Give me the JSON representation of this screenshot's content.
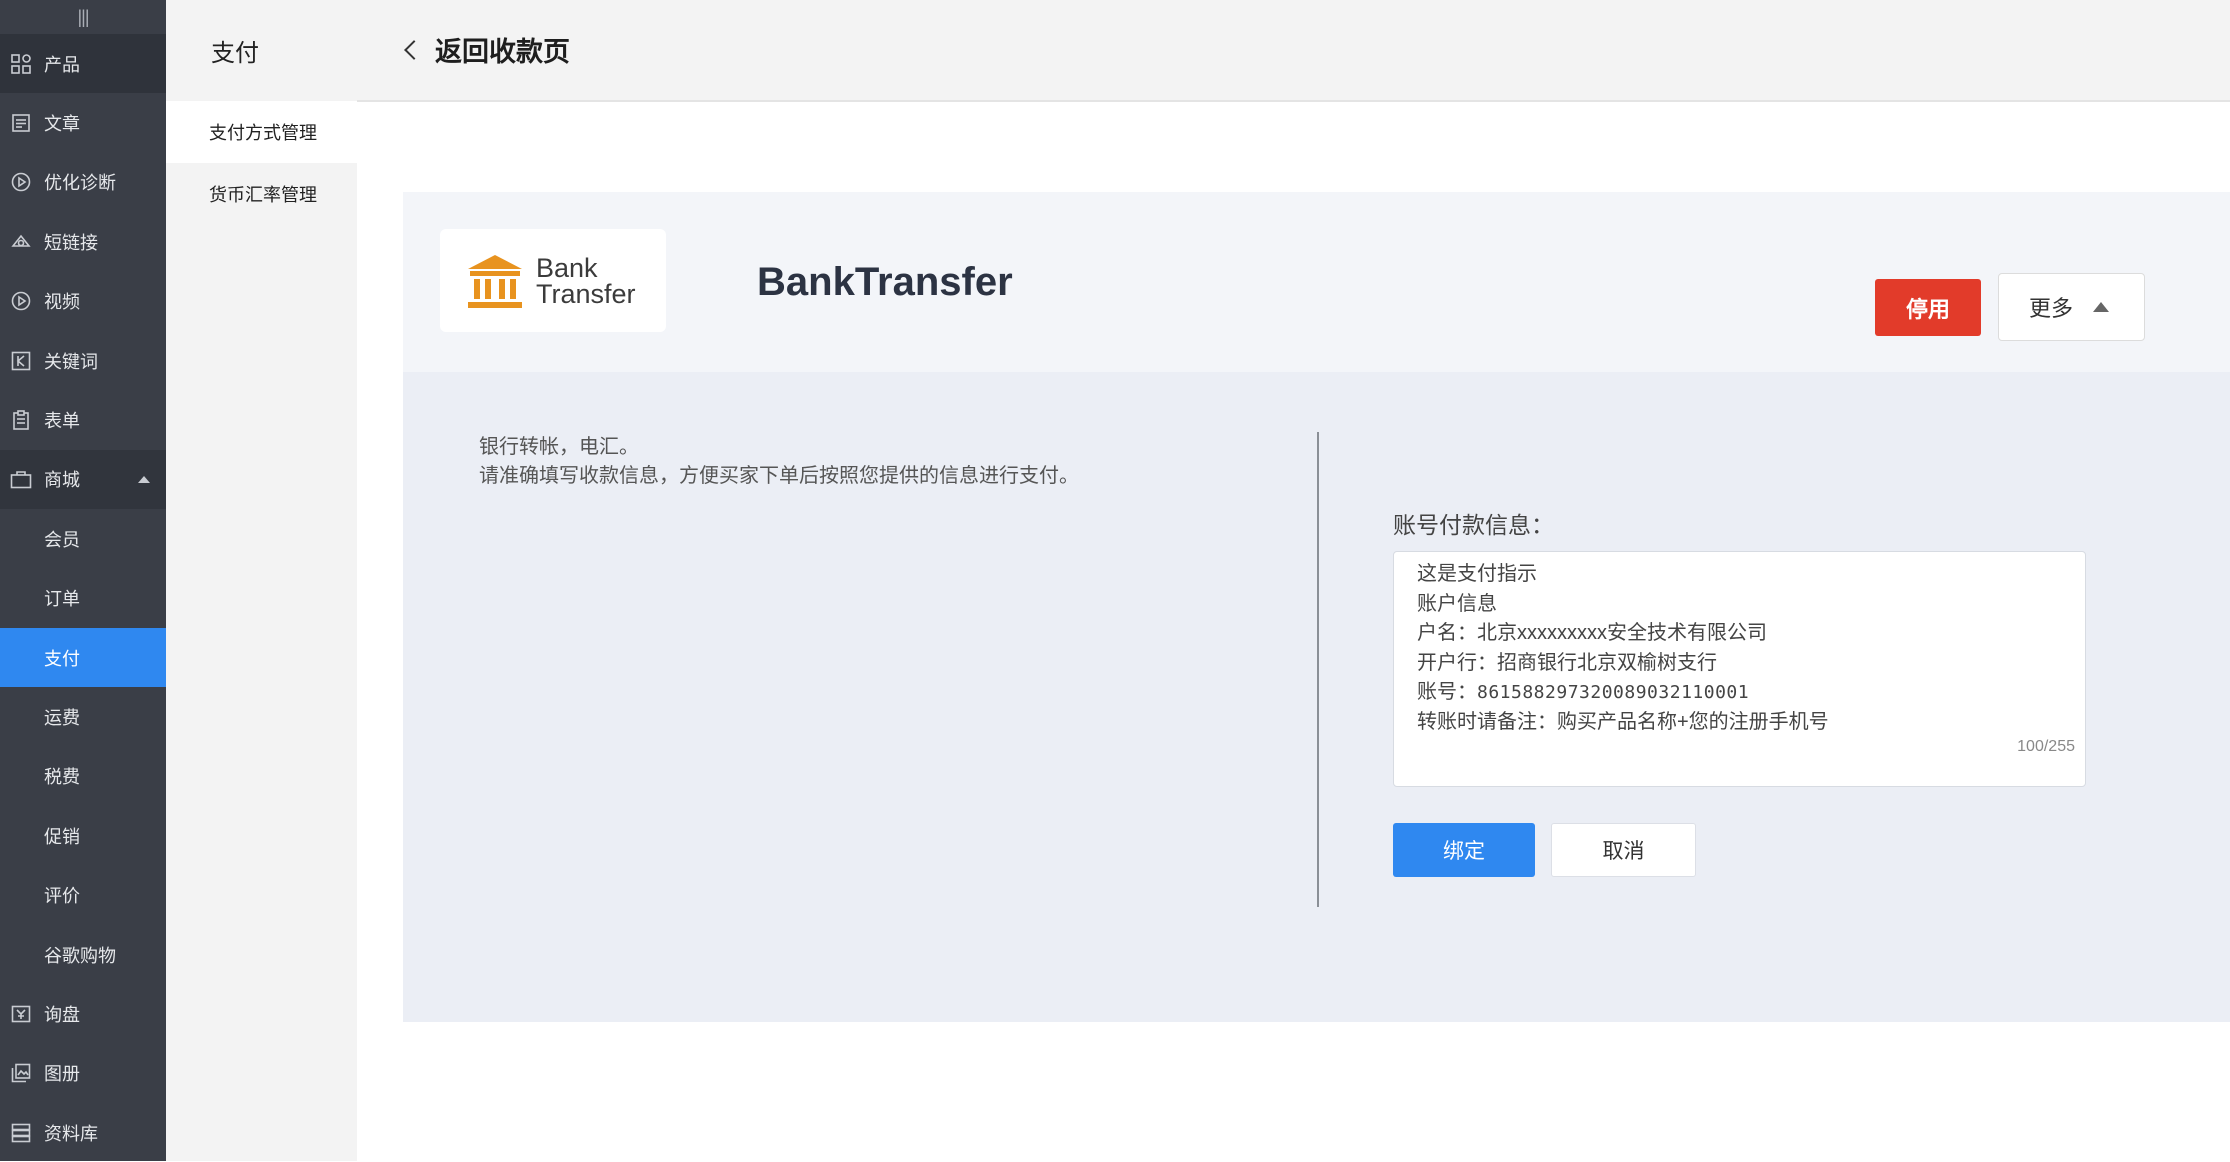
{
  "sidebar": {
    "collapse_glyph": "|||",
    "items": [
      {
        "label": "产品",
        "icon": "grid-icon"
      },
      {
        "label": "文章",
        "icon": "article-icon"
      },
      {
        "label": "优化诊断",
        "icon": "play-circle-icon"
      },
      {
        "label": "短链接",
        "icon": "link-icon"
      },
      {
        "label": "视频",
        "icon": "video-icon"
      },
      {
        "label": "关键词",
        "icon": "keyword-icon"
      },
      {
        "label": "表单",
        "icon": "clipboard-icon"
      },
      {
        "label": "商城",
        "icon": "shopping-bag-icon"
      },
      {
        "label": "会员"
      },
      {
        "label": "订单"
      },
      {
        "label": "支付"
      },
      {
        "label": "运费"
      },
      {
        "label": "税费"
      },
      {
        "label": "促销"
      },
      {
        "label": "评价"
      },
      {
        "label": "谷歌购物"
      },
      {
        "label": "询盘",
        "icon": "inquiry-icon"
      },
      {
        "label": "图册",
        "icon": "gallery-icon"
      },
      {
        "label": "资料库",
        "icon": "database-icon"
      }
    ]
  },
  "subnav": {
    "title": "支付",
    "items": [
      {
        "label": "支付方式管理"
      },
      {
        "label": "货币汇率管理"
      }
    ]
  },
  "header": {
    "back_label": "返回收款页"
  },
  "gateway": {
    "logo_line1": "Bank",
    "logo_line2": "Transfer",
    "name": "BankTransfer",
    "disable_label": "停用",
    "more_label": "更多",
    "description_line1": "银行转帐，电汇。",
    "description_line2": "请准确填写收款信息，方便买家下单后按照您提供的信息进行支付。"
  },
  "form": {
    "field_label": "账号付款信息：",
    "lines": [
      "这是支付指示",
      "账户信息",
      "户名：北京xxxxxxxxx安全技术有限公司",
      "开户行：招商银行北京双榆树支行",
      "账号：",
      "8615882973200890321100​01",
      "转账时请备注：购买产品名称+您的注册手机号"
    ],
    "account_number": "861588297320089032110001",
    "counter": "100/255",
    "bind_label": "绑定",
    "cancel_label": "取消"
  },
  "colors": {
    "sidebar_bg": "#3a3e47",
    "active_blue": "#2f88f0",
    "danger_red": "#e23b2a",
    "logo_orange": "#e8931f"
  }
}
